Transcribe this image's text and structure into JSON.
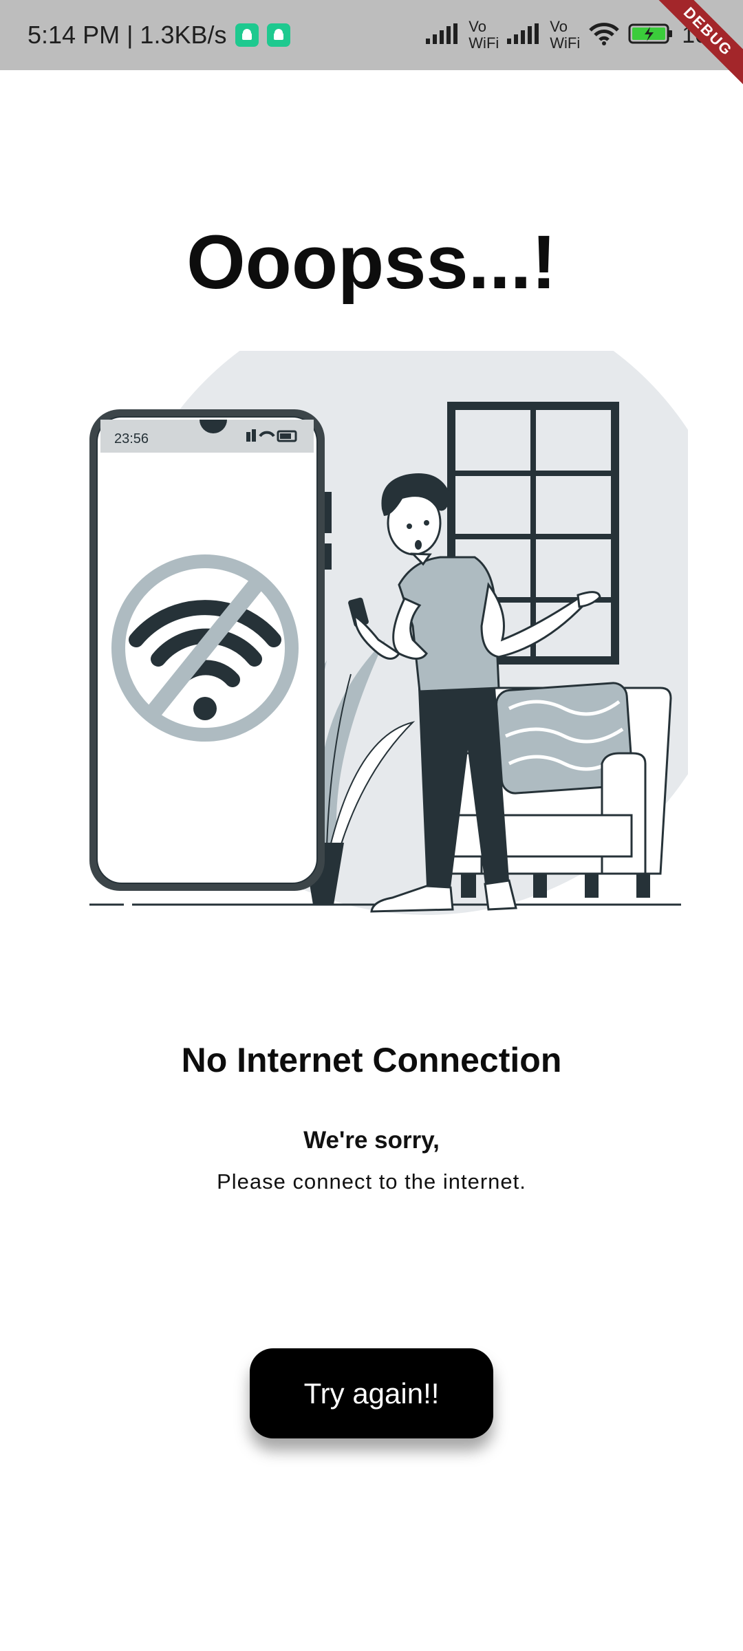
{
  "status_bar": {
    "time_speed": "5:14 PM | 1.3KB/s",
    "vowifi_top": "Vo",
    "vowifi_bottom": "WiFi",
    "battery": "100",
    "debug_label": "DEBUG"
  },
  "page": {
    "title": "Ooopss...!",
    "heading": "No Internet Connection",
    "apology": "We're sorry,",
    "instruction": "Please connect to the internet."
  },
  "illustration": {
    "phone_time": "23:56"
  },
  "actions": {
    "retry_label": "Try again!!"
  },
  "colors": {
    "accent": "#000000",
    "illustration_dark": "#263238",
    "illustration_gray": "#aebbc1",
    "circle_bg": "#e6e9ec"
  }
}
